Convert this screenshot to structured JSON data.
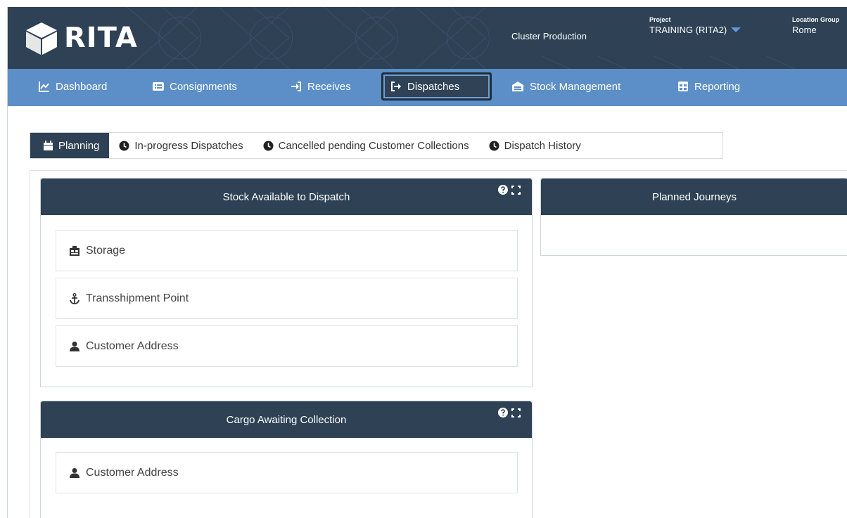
{
  "header": {
    "logo_text": "RITA",
    "cluster": "Cluster Production",
    "project_label": "Project",
    "project_value": "TRAINING (RITA2)",
    "location_label": "Location Group",
    "location_value": "Rome"
  },
  "nav": {
    "items": [
      {
        "label": "Dashboard",
        "icon": "chart-line-icon"
      },
      {
        "label": "Consignments",
        "icon": "list-icon"
      },
      {
        "label": "Receives",
        "icon": "sign-in-icon"
      },
      {
        "label": "Dispatches",
        "icon": "sign-out-icon",
        "active": true
      },
      {
        "label": "Stock Management",
        "icon": "warehouse-icon"
      },
      {
        "label": "Reporting",
        "icon": "table-icon"
      }
    ]
  },
  "tabs": [
    {
      "label": "Planning",
      "icon": "calendar-icon",
      "active": true
    },
    {
      "label": "In-progress Dispatches",
      "icon": "clock-icon"
    },
    {
      "label": "Cancelled pending Customer Collections",
      "icon": "clock-icon"
    },
    {
      "label": "Dispatch History",
      "icon": "clock-icon"
    }
  ],
  "panels": {
    "stock": {
      "title": "Stock Available to Dispatch",
      "rows": [
        {
          "label": "Storage",
          "icon": "storage-icon"
        },
        {
          "label": "Transshipment Point",
          "icon": "anchor-icon"
        },
        {
          "label": "Customer Address",
          "icon": "user-icon"
        }
      ]
    },
    "journeys": {
      "title": "Planned Journeys"
    },
    "cargo": {
      "title": "Cargo Awaiting Collection",
      "rows": [
        {
          "label": "Customer Address",
          "icon": "user-icon"
        }
      ]
    }
  },
  "colors": {
    "header_bg": "#2e4155",
    "nav_bg": "#5c8fc7",
    "accent_caret": "#5b9bd5"
  }
}
